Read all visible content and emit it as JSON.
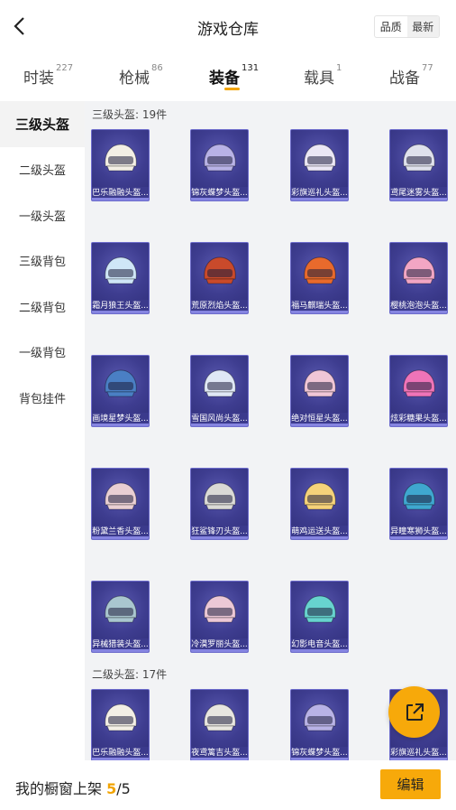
{
  "header": {
    "title": "游戏仓库",
    "sort_options": [
      "品质",
      "最新"
    ],
    "sort_selected": "最新"
  },
  "tabs": [
    {
      "label": "时装",
      "count": "227"
    },
    {
      "label": "枪械",
      "count": "86"
    },
    {
      "label": "装备",
      "count": "131",
      "active": true
    },
    {
      "label": "载具",
      "count": "1"
    },
    {
      "label": "战备",
      "count": "77"
    }
  ],
  "sidebar": {
    "items": [
      {
        "label": "三级头盔",
        "active": true
      },
      {
        "label": "二级头盔"
      },
      {
        "label": "一级头盔"
      },
      {
        "label": "三级背包"
      },
      {
        "label": "二级背包"
      },
      {
        "label": "一级背包"
      },
      {
        "label": "背包挂件"
      }
    ]
  },
  "sections": [
    {
      "title": "三级头盔: 19件",
      "items": [
        {
          "name": "巴乐融融头盔...",
          "color": "#f3efe5"
        },
        {
          "name": "锦灰蝶梦头盔...",
          "color": "#b8b2e6"
        },
        {
          "name": "彩旗巡礼头盔...",
          "color": "#ebe7f5"
        },
        {
          "name": "鸢尾迷雾头盔...",
          "color": "#dfe1ec"
        },
        {
          "name": "霜月狼王头盔...",
          "color": "#cfe6f7"
        },
        {
          "name": "荒原烈焰头盔...",
          "color": "#c94a2b"
        },
        {
          "name": "福马麒瑞头盔...",
          "color": "#e86a2c"
        },
        {
          "name": "樱桃泡泡头盔...",
          "color": "#f2a6c4"
        },
        {
          "name": "画境星梦头盔...",
          "color": "#4a7fc4"
        },
        {
          "name": "雪国风尚头盔...",
          "color": "#dfe8f5"
        },
        {
          "name": "绝对恒星头盔...",
          "color": "#f0c6d6"
        },
        {
          "name": "炫彩糖果头盔...",
          "color": "#ef74b8"
        },
        {
          "name": "粉黛兰香头盔...",
          "color": "#e9cfd3"
        },
        {
          "name": "狂鲨锋刃头盔...",
          "color": "#dadad6"
        },
        {
          "name": "萌鸡运送头盔...",
          "color": "#f5d27a"
        },
        {
          "name": "异瞳寒狮头盔...",
          "color": "#3fa7cf"
        },
        {
          "name": "异械猎装头盔...",
          "color": "#a9c6cf"
        },
        {
          "name": "冷漠罗丽头盔...",
          "color": "#ecc8d6"
        },
        {
          "name": "幻影电音头盔...",
          "color": "#67d3cf"
        }
      ]
    },
    {
      "title": "二级头盔: 17件",
      "items": [
        {
          "name": "巴乐融融头盔...",
          "color": "#f3efe5"
        },
        {
          "name": "夜鸢篱吉头盔...",
          "color": "#e8e6e0"
        },
        {
          "name": "锦灰蝶梦头盔...",
          "color": "#b8b2e6"
        },
        {
          "name": "彩旗巡礼头盔...",
          "color": "#ebe7f5"
        }
      ]
    }
  ],
  "bottom": {
    "prefix": "我的橱窗上架 ",
    "current": "5",
    "sep": "/",
    "total": "5",
    "edit_label": "编辑"
  }
}
